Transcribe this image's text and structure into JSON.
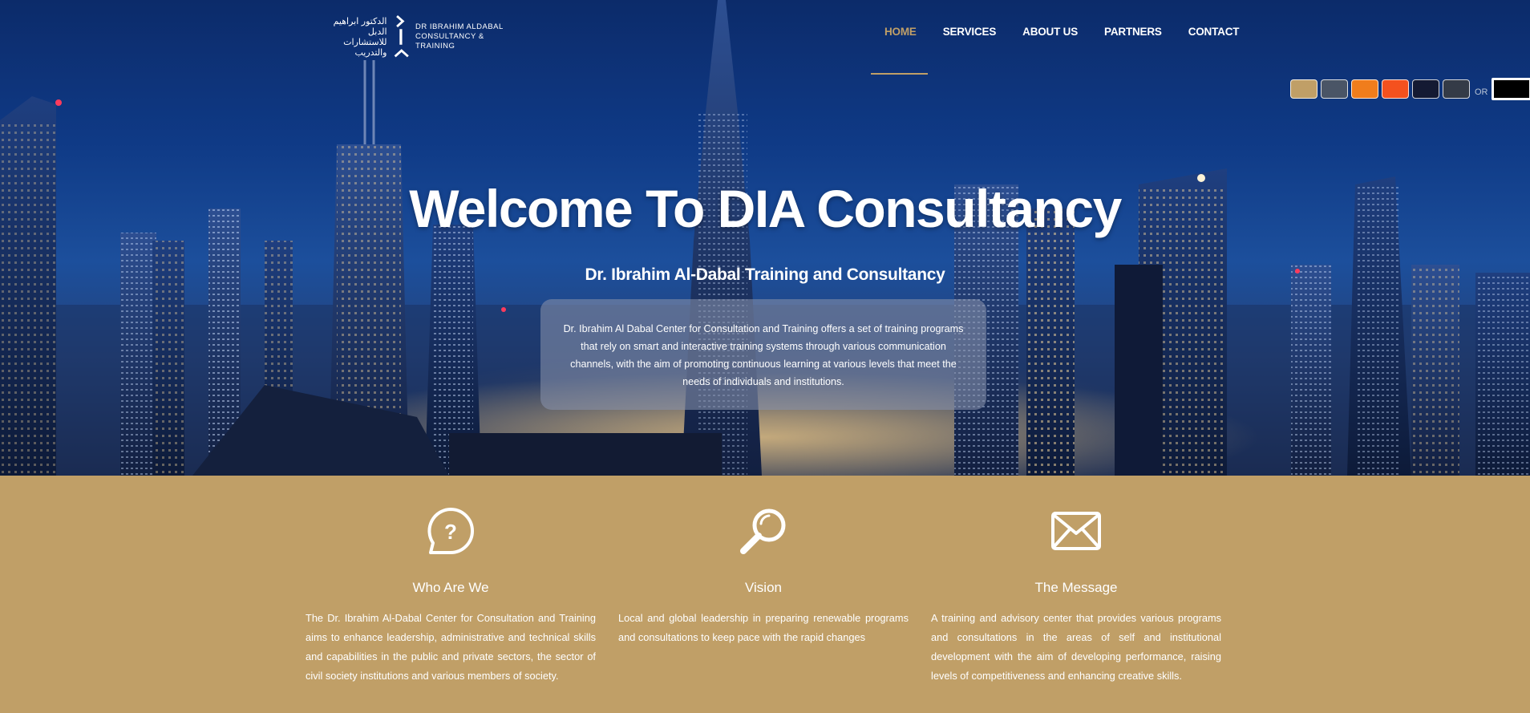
{
  "logo": {
    "arabic_line1": "الدكتور ابراهيم الدبل",
    "arabic_line2": "للاستشارات والتدريب",
    "english_line1": "DR IBRAHIM ALDABAL",
    "english_line2": "CONSULTANCY & TRAINING"
  },
  "nav": {
    "items": [
      {
        "label": "HOME",
        "active": true
      },
      {
        "label": "SERVICES",
        "active": false
      },
      {
        "label": "ABOUT US",
        "active": false
      },
      {
        "label": "PARTNERS",
        "active": false
      },
      {
        "label": "CONTACT",
        "active": false
      }
    ]
  },
  "theme_switcher": {
    "swatches": [
      "#c09f67",
      "#4a5566",
      "#f07d1c",
      "#f4511e",
      "#141a33",
      "#343b47"
    ],
    "or_label": "OR",
    "custom_color": "#000000"
  },
  "hero": {
    "title": "Welcome To DIA Consultancy",
    "subtitle": "Dr. Ibrahim Al-Dabal Training and Consultancy",
    "description": "Dr. Ibrahim Al Dabal Center for Consultation and Training offers a set of training programs that rely on smart and interactive training systems through various communication channels, with the aim of promoting continuous learning at various levels that meet the needs of individuals and institutions."
  },
  "features": [
    {
      "icon": "question-bubble-icon",
      "title": "Who Are We",
      "text": "The Dr. Ibrahim Al-Dabal Center for Consultation and Training aims to enhance leadership, administrative and technical skills and capabilities in the public and private sectors, the sector of civil society institutions and various members of society."
    },
    {
      "icon": "search-icon",
      "title": "Vision",
      "text": "Local and global leadership in preparing renewable programs and consultations to keep pace with the rapid changes"
    },
    {
      "icon": "envelope-icon",
      "title": "The Message",
      "text": "A training and advisory center that provides various programs and consultations in the areas of self and institutional development with the aim of developing performance, raising levels of competitiveness and enhancing creative skills."
    }
  ],
  "colors": {
    "accent": "#c09f67",
    "hero_blue": "#0f3a86",
    "text": "#ffffff"
  }
}
